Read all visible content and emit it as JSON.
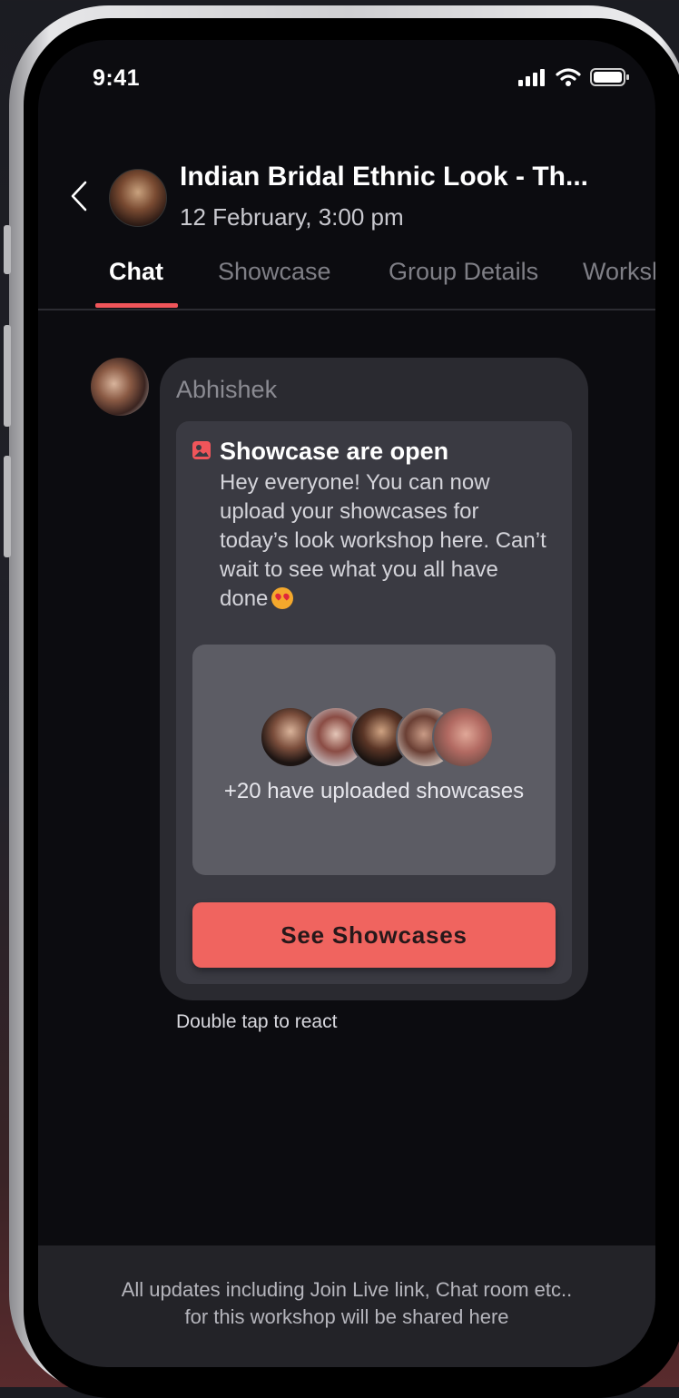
{
  "status_bar": {
    "time": "9:41"
  },
  "header": {
    "title": "Indian Bridal Ethnic Look - Th...",
    "subtitle": "12 February, 3:00 pm"
  },
  "tabs": [
    {
      "label": "Chat",
      "active": true
    },
    {
      "label": "Showcase",
      "active": false
    },
    {
      "label": "Group Details",
      "active": false
    },
    {
      "label": "Worksh",
      "active": false
    }
  ],
  "message": {
    "sender": "Abhishek",
    "card_title": "Showcase are open",
    "card_body": "Hey everyone! You can now upload your showcases for today’s look workshop here. Can’t wait to see what you all have done",
    "emoji": "heart-eyes-emoji",
    "uploaded_text": "+20 have uploaded showcases",
    "button_label": "See Showcases",
    "reaction_hint": "Double tap to react"
  },
  "footer": {
    "line1": "All updates including Join Live link, Chat room etc..",
    "line2": "for this workshop will be shared here"
  },
  "colors": {
    "accent": "#f0645f",
    "tab_indicator": "#f0555a",
    "screen_bg": "#0c0c10",
    "bubble_bg": "#2a2a30"
  },
  "icons": {
    "back": "chevron-left-icon",
    "signal": "signal-icon",
    "wifi": "wifi-icon",
    "battery": "battery-icon",
    "showcase": "image-icon"
  }
}
